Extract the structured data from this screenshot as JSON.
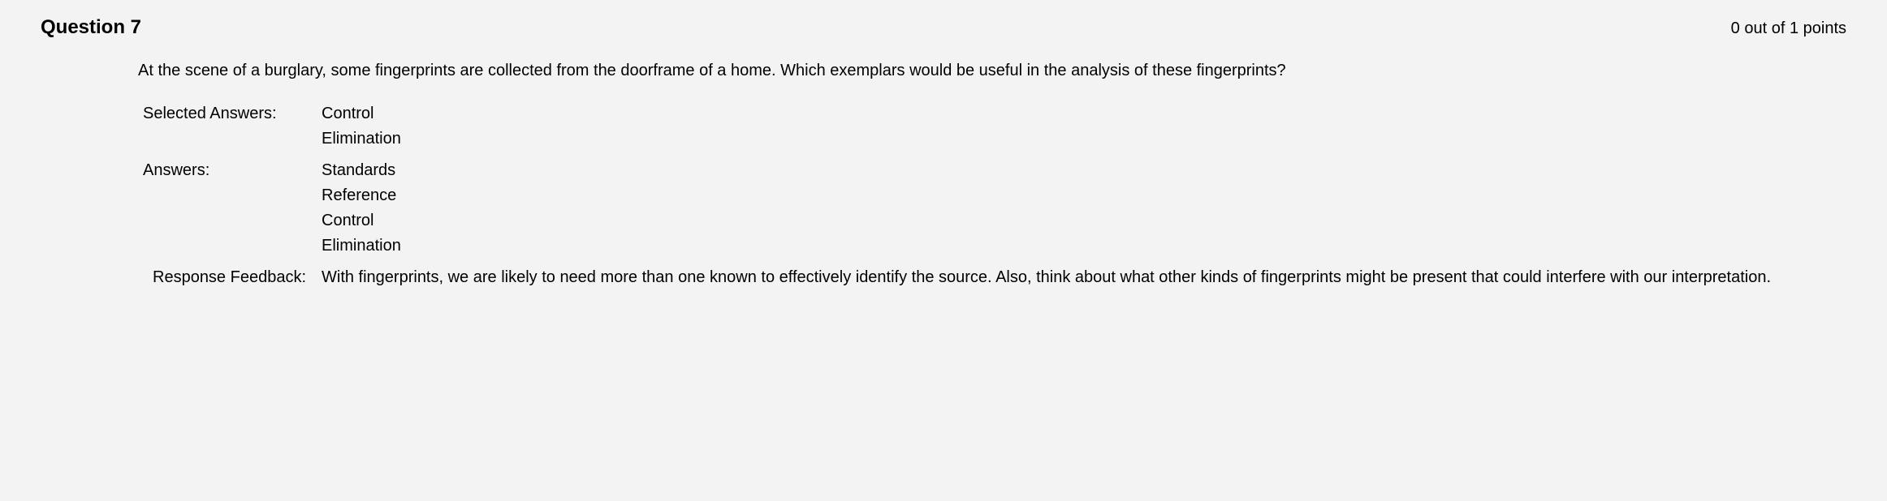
{
  "header": {
    "title": "Question 7",
    "points": "0 out of 1 points"
  },
  "question": {
    "text": "At the scene of a burglary, some fingerprints are collected from the doorframe of a home. Which exemplars would be useful in the analysis of these fingerprints?"
  },
  "selected_answers": {
    "label": "Selected Answers:",
    "items": [
      "Control",
      "Elimination"
    ]
  },
  "answers": {
    "label": "Answers:",
    "items": [
      "Standards",
      "Reference",
      "Control",
      "Elimination"
    ]
  },
  "feedback": {
    "label": "Response Feedback:",
    "text": "With fingerprints, we are likely to need more than one known to effectively identify the source. Also, think about what other kinds of fingerprints might be present that could interfere with our interpretation."
  }
}
